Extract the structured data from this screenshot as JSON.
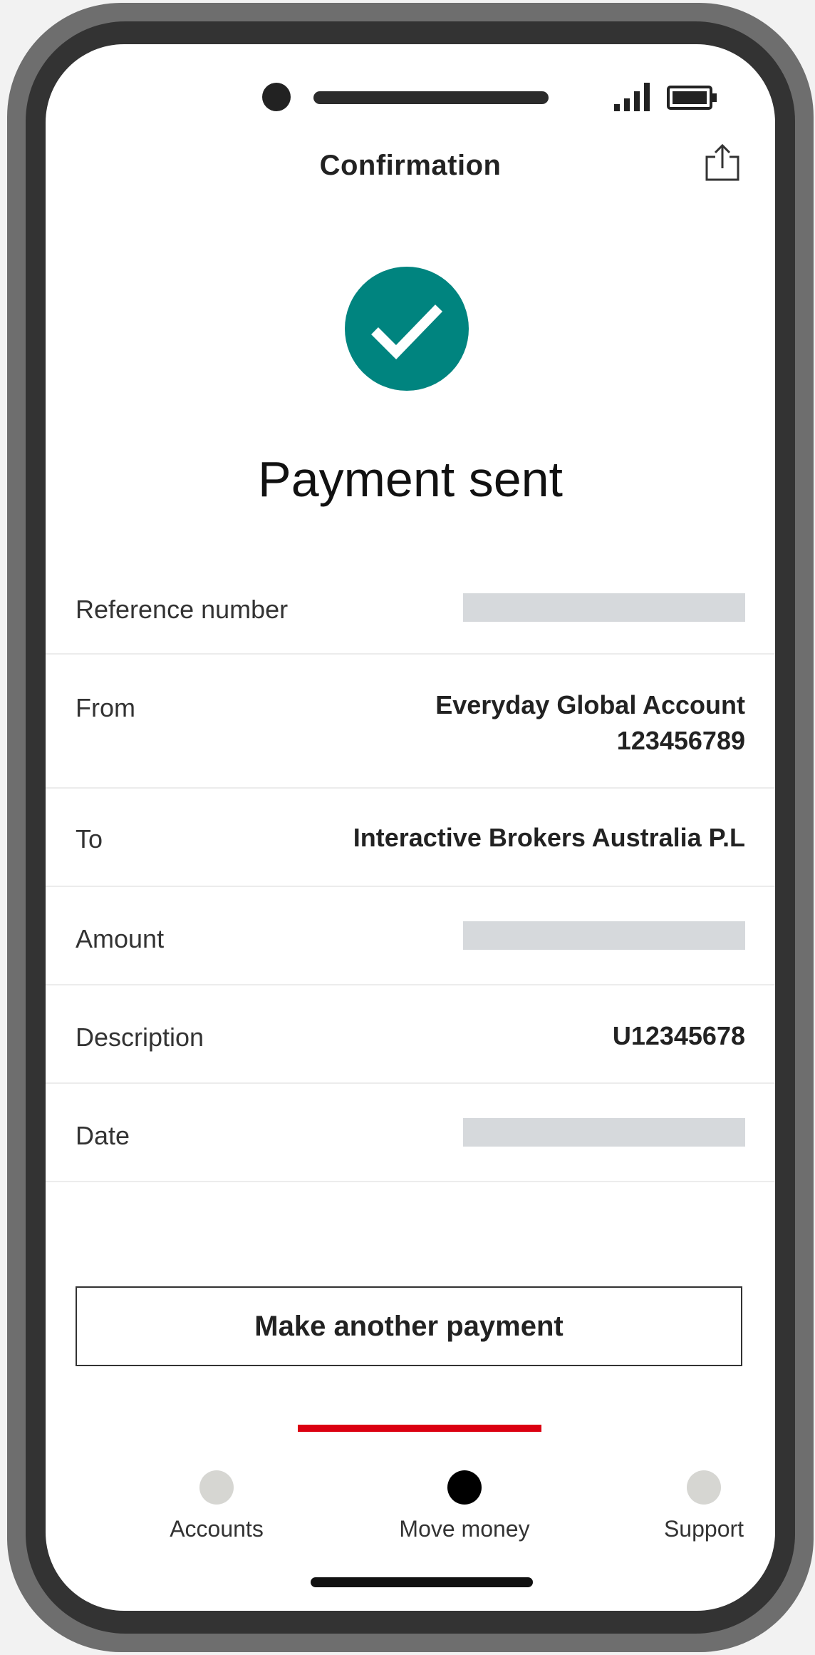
{
  "header": {
    "title": "Confirmation",
    "share_icon": "share-icon"
  },
  "status": {
    "title": "Payment sent",
    "icon": "checkmark-icon",
    "accent_color": "#00847f"
  },
  "details": {
    "reference": {
      "label": "Reference number"
    },
    "from": {
      "label": "From",
      "account_name": "Everyday Global Account",
      "account_number": "123456789"
    },
    "to": {
      "label": "To",
      "value": "Interactive Brokers Australia P.L"
    },
    "amount": {
      "label": "Amount"
    },
    "description": {
      "label": "Description",
      "value": "U12345678"
    },
    "date": {
      "label": "Date"
    }
  },
  "actions": {
    "make_another": "Make another payment"
  },
  "nav": {
    "active_color": "#db0011",
    "items": [
      {
        "label": "Accounts"
      },
      {
        "label": "Move money"
      },
      {
        "label": "Support"
      }
    ]
  }
}
